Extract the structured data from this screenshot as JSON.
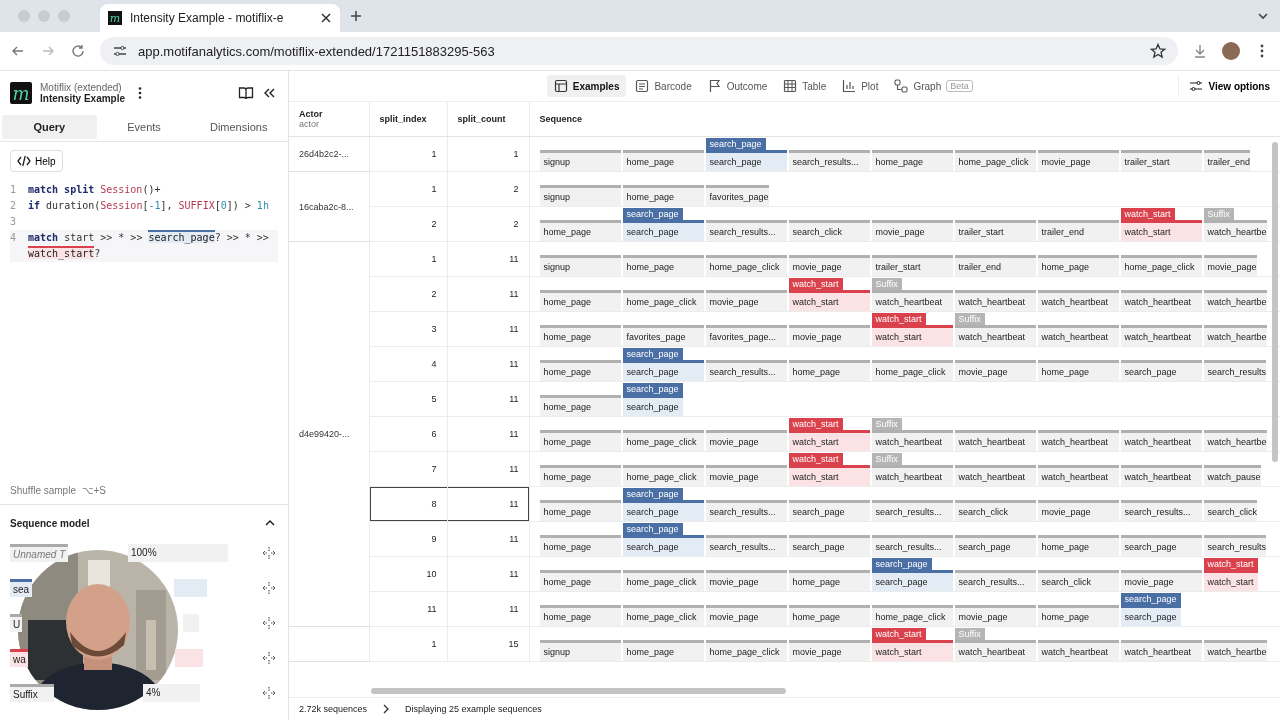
{
  "browser": {
    "favicon": "m",
    "tab_title": "Intensity Example - motiflix-e",
    "url": "app.motifanalytics.com/motiflix-extended/1721151883295-563"
  },
  "app": {
    "logo": "m",
    "project": "Motiflix (extended)",
    "name": "Intensity Example"
  },
  "left_tabs": [
    {
      "label": "Query",
      "selected": true
    },
    {
      "label": "Events",
      "selected": false
    },
    {
      "label": "Dimensions",
      "selected": false
    }
  ],
  "help": "Help",
  "editor": [
    {
      "number": "1",
      "tokens": [
        {
          "text": "match split ",
          "kind": "kw"
        },
        {
          "text": "Session",
          "kind": "name"
        },
        {
          "text": "()+",
          "kind": "op"
        }
      ]
    },
    {
      "number": "2",
      "tokens": [
        {
          "text": "if",
          "kind": "kw"
        },
        {
          "text": " duration(",
          "kind": "op"
        },
        {
          "text": "Session",
          "kind": "name"
        },
        {
          "text": "[",
          "kind": "op"
        },
        {
          "text": "-1",
          "kind": "num"
        },
        {
          "text": "], ",
          "kind": "op"
        },
        {
          "text": "SUFFIX",
          "kind": "name"
        },
        {
          "text": "[",
          "kind": "op"
        },
        {
          "text": "0",
          "kind": "num"
        },
        {
          "text": "]) > ",
          "kind": "op"
        },
        {
          "text": "1h",
          "kind": "num"
        }
      ]
    },
    {
      "number": "3"
    },
    {
      "number": "4",
      "tokens": [
        {
          "text": "match",
          "kind": "kw"
        },
        {
          "text": " start >> * >> ",
          "kind": "op"
        },
        {
          "text": "search_page",
          "kind": "search"
        },
        {
          "text": "? >> * >> ",
          "kind": "op"
        },
        {
          "text": "watch_start",
          "kind": "watch"
        },
        {
          "text": "?",
          "kind": "op"
        }
      ]
    }
  ],
  "shuffle": "Shuffle sample  ⌥+S",
  "sequence_model": {
    "title": "Sequence model",
    "items": [
      {
        "label": "Unnamed T",
        "kind": "plain",
        "share": "100%"
      },
      {
        "label": "sea",
        "kind": "search"
      },
      {
        "label": "U",
        "kind": "plain"
      },
      {
        "label": "wa",
        "kind": "watch"
      },
      {
        "label": "Suffix",
        "kind": "suffix",
        "share": "4%"
      }
    ]
  },
  "view_tabs": [
    {
      "label": "Examples",
      "kind": "examples",
      "selected": true
    },
    {
      "label": "Barcode",
      "kind": "barcode",
      "selected": false
    },
    {
      "label": "Outcome",
      "kind": "outcome",
      "selected": false
    },
    {
      "label": "Table",
      "kind": "table",
      "selected": false
    },
    {
      "label": "Plot",
      "kind": "plot",
      "selected": false
    },
    {
      "label": "Graph",
      "kind": "graph",
      "selected": false,
      "badge": "Beta"
    }
  ],
  "view_options": "View options",
  "table": {
    "columns": [
      {
        "label": "Actor",
        "sub": "actor"
      },
      {
        "label": "split_index"
      },
      {
        "label": "split_count"
      },
      {
        "label": "Sequence"
      }
    ],
    "groups": [
      {
        "actor": "26d4b2c2-...",
        "rows": [
          {
            "split_index": "1",
            "split_count": "1",
            "selected": false,
            "events": [
              {
                "name": "signup"
              },
              {
                "name": "home_page"
              },
              {
                "name": "search_page",
                "kind": "search",
                "tag_label": "search_page"
              },
              {
                "name": "search_results..."
              },
              {
                "name": "home_page"
              },
              {
                "name": "home_page_click"
              },
              {
                "name": "movie_page"
              },
              {
                "name": "trailer_start"
              },
              {
                "name": "trailer_end"
              }
            ]
          }
        ]
      },
      {
        "actor": "16caba2c-8...",
        "rows": [
          {
            "split_index": "1",
            "split_count": "2",
            "selected": false,
            "events": [
              {
                "name": "signup"
              },
              {
                "name": "home_page"
              },
              {
                "name": "favorites_page"
              }
            ]
          },
          {
            "split_index": "2",
            "split_count": "2",
            "selected": false,
            "events": [
              {
                "name": "home_page"
              },
              {
                "name": "search_page",
                "kind": "search",
                "tag_label": "search_page"
              },
              {
                "name": "search_results..."
              },
              {
                "name": "search_click"
              },
              {
                "name": "movie_page"
              },
              {
                "name": "trailer_start"
              },
              {
                "name": "trailer_end"
              },
              {
                "name": "watch_start",
                "kind": "watch",
                "tag_label": "watch_start"
              },
              {
                "name": "watch_heartbe",
                "kind": "suffix",
                "tag_label": "Suffix"
              }
            ]
          }
        ]
      },
      {
        "actor": "d4e99420-...",
        "rows": [
          {
            "split_index": "1",
            "split_count": "11",
            "selected": false,
            "events": [
              {
                "name": "signup"
              },
              {
                "name": "home_page"
              },
              {
                "name": "home_page_click"
              },
              {
                "name": "movie_page"
              },
              {
                "name": "trailer_start"
              },
              {
                "name": "trailer_end"
              },
              {
                "name": "home_page"
              },
              {
                "name": "home_page_click"
              },
              {
                "name": "movie_page"
              }
            ]
          },
          {
            "split_index": "2",
            "split_count": "11",
            "selected": false,
            "events": [
              {
                "name": "home_page"
              },
              {
                "name": "home_page_click"
              },
              {
                "name": "movie_page"
              },
              {
                "name": "watch_start",
                "kind": "watch",
                "tag_label": "watch_start"
              },
              {
                "name": "watch_heartbeat",
                "kind": "suffix",
                "tag_label": "Suffix"
              },
              {
                "name": "watch_heartbeat"
              },
              {
                "name": "watch_heartbeat"
              },
              {
                "name": "watch_heartbeat"
              },
              {
                "name": "watch_heartbe"
              }
            ]
          },
          {
            "split_index": "3",
            "split_count": "11",
            "selected": false,
            "events": [
              {
                "name": "home_page"
              },
              {
                "name": "favorites_page"
              },
              {
                "name": "favorites_page..."
              },
              {
                "name": "movie_page"
              },
              {
                "name": "watch_start",
                "kind": "watch",
                "tag_label": "watch_start"
              },
              {
                "name": "watch_heartbeat",
                "kind": "suffix",
                "tag_label": "Suffix"
              },
              {
                "name": "watch_heartbeat"
              },
              {
                "name": "watch_heartbeat"
              },
              {
                "name": "watch_heartbe"
              }
            ]
          },
          {
            "split_index": "4",
            "split_count": "11",
            "selected": false,
            "events": [
              {
                "name": "home_page"
              },
              {
                "name": "search_page",
                "kind": "search",
                "tag_label": "search_page"
              },
              {
                "name": "search_results..."
              },
              {
                "name": "home_page"
              },
              {
                "name": "home_page_click"
              },
              {
                "name": "movie_page"
              },
              {
                "name": "home_page"
              },
              {
                "name": "search_page"
              },
              {
                "name": "search_results"
              }
            ]
          },
          {
            "split_index": "5",
            "split_count": "11",
            "selected": false,
            "events": [
              {
                "name": "home_page"
              },
              {
                "name": "search_page",
                "kind": "search",
                "tag_label": "search_page"
              }
            ]
          },
          {
            "split_index": "6",
            "split_count": "11",
            "selected": false,
            "events": [
              {
                "name": "home_page"
              },
              {
                "name": "home_page_click"
              },
              {
                "name": "movie_page"
              },
              {
                "name": "watch_start",
                "kind": "watch",
                "tag_label": "watch_start"
              },
              {
                "name": "watch_heartbeat",
                "kind": "suffix",
                "tag_label": "Suffix"
              },
              {
                "name": "watch_heartbeat"
              },
              {
                "name": "watch_heartbeat"
              },
              {
                "name": "watch_heartbeat"
              },
              {
                "name": "watch_heartbe"
              }
            ]
          },
          {
            "split_index": "7",
            "split_count": "11",
            "selected": false,
            "events": [
              {
                "name": "home_page"
              },
              {
                "name": "home_page_click"
              },
              {
                "name": "movie_page"
              },
              {
                "name": "watch_start",
                "kind": "watch",
                "tag_label": "watch_start"
              },
              {
                "name": "watch_heartbeat",
                "kind": "suffix",
                "tag_label": "Suffix"
              },
              {
                "name": "watch_heartbeat"
              },
              {
                "name": "watch_heartbeat"
              },
              {
                "name": "watch_heartbeat"
              },
              {
                "name": "watch_pause"
              }
            ]
          },
          {
            "split_index": "8",
            "split_count": "11",
            "selected": true,
            "events": [
              {
                "name": "home_page"
              },
              {
                "name": "search_page",
                "kind": "search",
                "tag_label": "search_page"
              },
              {
                "name": "search_results..."
              },
              {
                "name": "search_page"
              },
              {
                "name": "search_results..."
              },
              {
                "name": "search_click"
              },
              {
                "name": "movie_page"
              },
              {
                "name": "search_results..."
              },
              {
                "name": "search_click"
              }
            ]
          },
          {
            "split_index": "9",
            "split_count": "11",
            "selected": false,
            "events": [
              {
                "name": "home_page"
              },
              {
                "name": "search_page",
                "kind": "search",
                "tag_label": "search_page"
              },
              {
                "name": "search_results..."
              },
              {
                "name": "search_page"
              },
              {
                "name": "search_results..."
              },
              {
                "name": "search_page"
              },
              {
                "name": "home_page"
              },
              {
                "name": "search_page"
              },
              {
                "name": "search_results"
              }
            ]
          },
          {
            "split_index": "10",
            "split_count": "11",
            "selected": false,
            "events": [
              {
                "name": "home_page"
              },
              {
                "name": "home_page_click"
              },
              {
                "name": "movie_page"
              },
              {
                "name": "home_page"
              },
              {
                "name": "search_page",
                "kind": "search",
                "tag_label": "search_page"
              },
              {
                "name": "search_results..."
              },
              {
                "name": "search_click"
              },
              {
                "name": "movie_page"
              },
              {
                "name": "watch_start",
                "kind": "watch",
                "tag_label": "watch_start"
              }
            ]
          },
          {
            "split_index": "11",
            "split_count": "11",
            "selected": false,
            "events": [
              {
                "name": "home_page"
              },
              {
                "name": "home_page_click"
              },
              {
                "name": "movie_page"
              },
              {
                "name": "home_page"
              },
              {
                "name": "home_page_click"
              },
              {
                "name": "movie_page"
              },
              {
                "name": "home_page"
              },
              {
                "name": "search_page",
                "kind": "search",
                "tag_label": "search_page"
              }
            ]
          }
        ]
      },
      {
        "rows": [
          {
            "split_index": "1",
            "split_count": "15",
            "selected": false,
            "events": [
              {
                "name": "signup"
              },
              {
                "name": "home_page"
              },
              {
                "name": "home_page_click"
              },
              {
                "name": "movie_page"
              },
              {
                "name": "watch_start",
                "kind": "watch",
                "tag_label": "watch_start"
              },
              {
                "name": "watch_heartbeat",
                "kind": "suffix",
                "tag_label": "Suffix"
              },
              {
                "name": "watch_heartbeat"
              },
              {
                "name": "watch_heartbeat"
              },
              {
                "name": "watch_heartbe"
              }
            ]
          }
        ]
      }
    ]
  },
  "footer": {
    "count": "2.72k sequences",
    "message": "Displaying 25 example sequences"
  }
}
